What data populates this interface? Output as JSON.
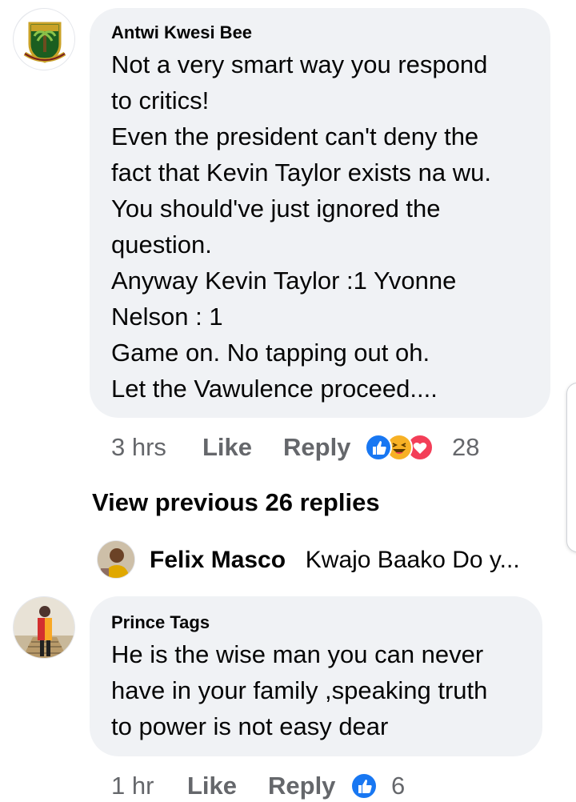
{
  "comments": [
    {
      "author": "Antwi Kwesi Bee",
      "lines": [
        "Not a very smart way you respond",
        "to critics!",
        "Even the president can't deny the",
        "fact that Kevin Taylor exists na wu.",
        "You should've just ignored the",
        "question.",
        "Anyway Kevin Taylor :1 Yvonne",
        "Nelson : 1",
        "Game on. No tapping out oh.",
        "Let the Vawulence proceed...."
      ],
      "time": "3 hrs",
      "like_label": "Like",
      "reply_label": "Reply",
      "reactions": [
        "like-icon",
        "haha-icon",
        "love-icon"
      ],
      "reaction_count": "28"
    },
    {
      "author": "Prince Tags",
      "lines": [
        "He is the wise man you can never",
        "have in your family ,speaking truth",
        "to power is not easy dear"
      ],
      "time": "1 hr",
      "like_label": "Like",
      "reply_label": "Reply",
      "reactions": [
        "like-icon"
      ],
      "reaction_count": "6"
    }
  ],
  "view_previous": "View previous 26 replies",
  "reply_preview": {
    "author": "Felix Masco",
    "text": "Kwajo Baako Do y..."
  },
  "colors": {
    "bubble": "#f0f2f5",
    "meta_text": "#65676b",
    "like_blue": "#1877f2",
    "love_red": "#f33e58",
    "haha_yellow": "#f7b125"
  }
}
